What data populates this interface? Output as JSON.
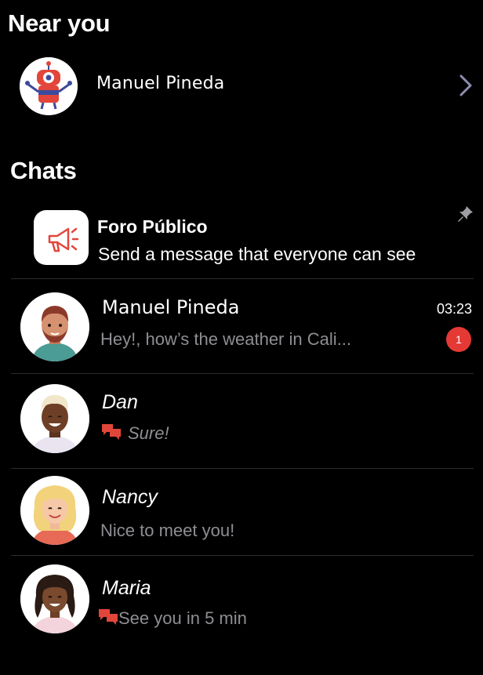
{
  "near_you": {
    "title": "Near you",
    "contact_name": "Manuel Pineda"
  },
  "chats": {
    "title": "Chats",
    "items": [
      {
        "name": "Foro Público",
        "preview": "Send a message that everyone can see",
        "pinned": true,
        "icon": "megaphone-icon"
      },
      {
        "name": "Manuel Pineda",
        "preview": "Hey!, how’s the weather in Cali...",
        "time": "03:23",
        "unread": "1"
      },
      {
        "name": "Dan",
        "preview": "Sure!",
        "icon": "chat-bubbles-icon"
      },
      {
        "name": "Nancy",
        "preview": "Nice to meet you!"
      },
      {
        "name": "Maria",
        "preview": "See you in 5 min",
        "icon": "chat-bubbles-icon"
      }
    ]
  },
  "colors": {
    "background": "#000000",
    "accent_red": "#e53935",
    "secondary_text": "#8e8e93",
    "chevron": "#8e8eb0"
  }
}
